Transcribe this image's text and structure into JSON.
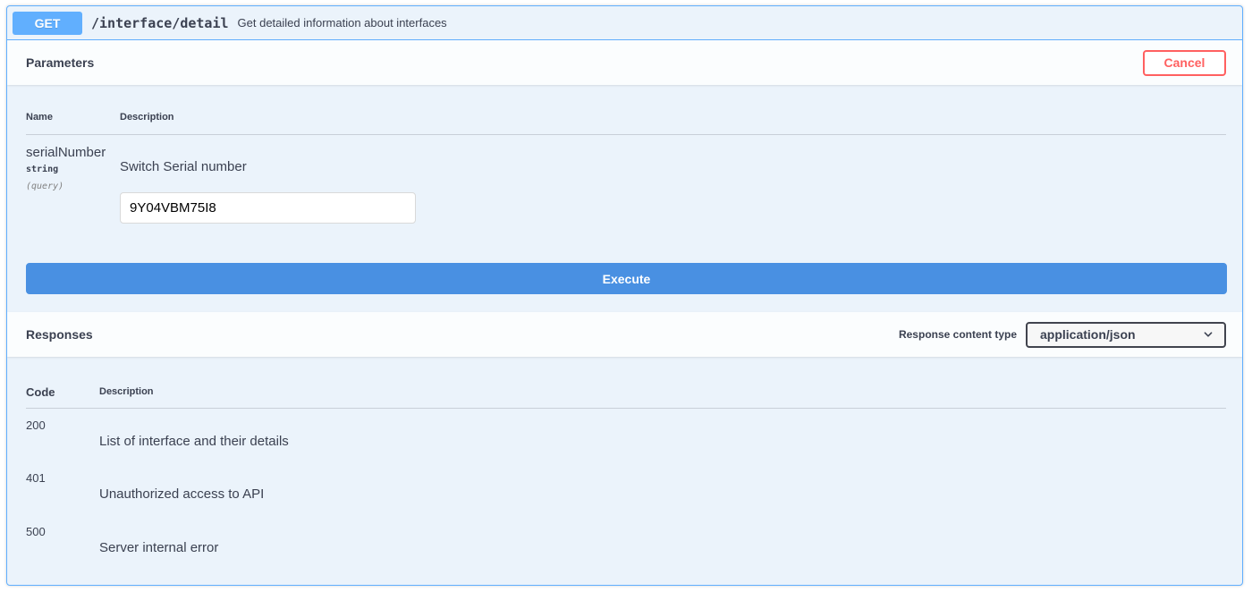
{
  "summary": {
    "method": "GET",
    "path": "/interface/detail",
    "description": "Get detailed information about interfaces"
  },
  "parameters": {
    "title": "Parameters",
    "cancel_label": "Cancel",
    "col_name": "Name",
    "col_description": "Description",
    "items": [
      {
        "name": "serialNumber",
        "type": "string",
        "in": "(query)",
        "description": "Switch Serial number",
        "value": "9Y04VBM75I8"
      }
    ],
    "execute_label": "Execute"
  },
  "responses": {
    "title": "Responses",
    "content_type_label": "Response content type",
    "content_type_value": "application/json",
    "col_code": "Code",
    "col_description": "Description",
    "rows": [
      {
        "code": "200",
        "description": "List of interface and their details"
      },
      {
        "code": "401",
        "description": "Unauthorized access to API"
      },
      {
        "code": "500",
        "description": "Server internal error"
      }
    ]
  },
  "colors": {
    "get_accent": "#61affe",
    "cancel": "#ff6060",
    "execute": "#4990e2",
    "panel_bg": "#ebf3fb"
  }
}
